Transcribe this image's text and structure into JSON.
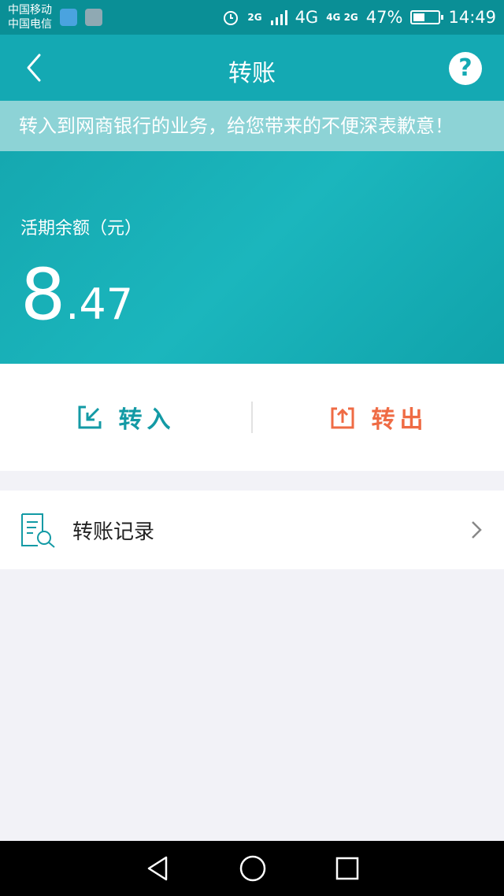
{
  "status_bar": {
    "carrier_1": "中国移动",
    "carrier_2": "中国电信",
    "signal_2g": "2G",
    "signal_4g": "4G",
    "signal_4g_2g": "4G 2G",
    "battery": "47%",
    "time": "14:49"
  },
  "header": {
    "title": "转账",
    "help_label": "?"
  },
  "notice": {
    "text": "转入到网商银行的业务，给您带来的不便深表歉意！"
  },
  "balance": {
    "label": "活期余额（元）",
    "integer": "8",
    "decimal": ".47"
  },
  "actions": {
    "transfer_in": "转入",
    "transfer_out": "转出"
  },
  "records": {
    "label": "转账记录"
  },
  "colors": {
    "primary": "#14a9b3",
    "transfer_out": "#ef6b44"
  }
}
